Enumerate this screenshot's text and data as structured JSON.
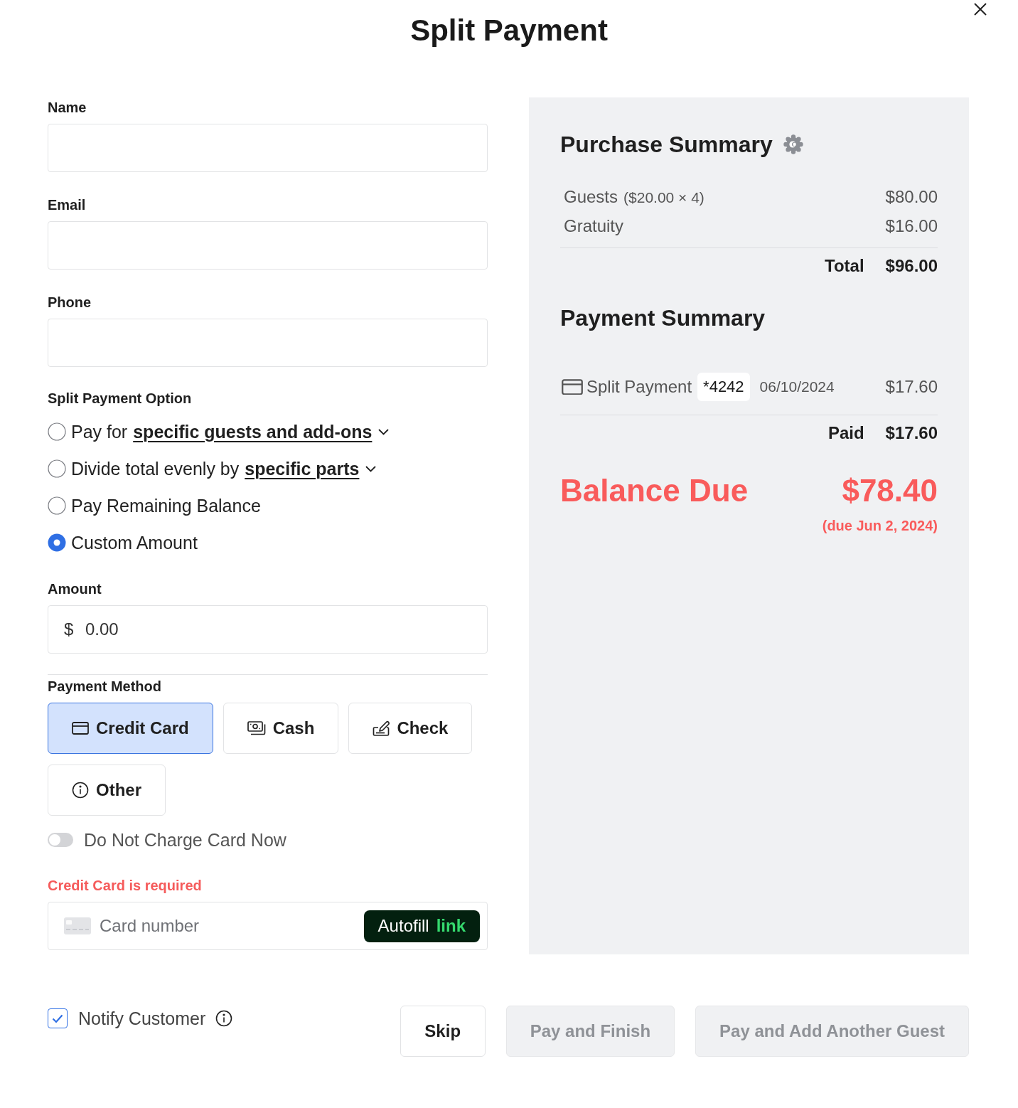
{
  "dialog": {
    "title": "Split Payment"
  },
  "form": {
    "fields": [
      {
        "label": "Name"
      },
      {
        "label": "Email"
      },
      {
        "label": "Phone"
      }
    ],
    "split_option": {
      "label": "Split Payment Option",
      "options": [
        {
          "text": "Pay for",
          "link": "specific guests and add-ons",
          "selected": false
        },
        {
          "text": "Divide total evenly by",
          "link": "specific parts",
          "selected": false
        },
        {
          "text": "Pay Remaining Balance",
          "selected": false
        },
        {
          "text": "Custom Amount",
          "selected": true
        }
      ]
    },
    "amount": {
      "label": "Amount",
      "prefix": "$",
      "value": "0.00"
    },
    "payment_method": {
      "label": "Payment Method",
      "methods": [
        {
          "kind": "card",
          "label": "Credit Card",
          "selected": true
        },
        {
          "kind": "cash",
          "label": "Cash",
          "selected": false
        },
        {
          "kind": "check",
          "label": "Check",
          "selected": false
        },
        {
          "kind": "other",
          "label": "Other",
          "selected": false
        }
      ]
    },
    "charge_toggle": {
      "label": "Do Not Charge Card Now",
      "on": false
    },
    "card_error": "Credit Card is required",
    "card_field": {
      "placeholder": "Card number",
      "autofill": {
        "label": "Autofill",
        "brand": "link"
      }
    }
  },
  "purchase_summary": {
    "title": "Purchase Summary",
    "items": [
      {
        "label": "Guests",
        "detail": "($20.00 × 4)",
        "amount": "$80.00"
      },
      {
        "label": "Gratuity",
        "amount": "$16.00"
      }
    ],
    "total": {
      "label": "Total",
      "amount": "$96.00"
    }
  },
  "payment_summary": {
    "title": "Payment Summary",
    "payments": [
      {
        "label": "Split Payment",
        "card": "*4242",
        "date": "06/10/2024",
        "amount": "$17.60"
      }
    ],
    "paid": {
      "label": "Paid",
      "amount": "$17.60"
    }
  },
  "balance": {
    "label": "Balance Due",
    "amount": "$78.40",
    "due": "(due Jun 2, 2024)"
  },
  "footer": {
    "notify": {
      "label": "Notify Customer",
      "checked": true
    },
    "buttons": [
      {
        "label": "Skip",
        "disabled": false
      },
      {
        "label": "Pay and Finish",
        "disabled": true
      },
      {
        "label": "Pay and Add Another Guest",
        "disabled": true
      }
    ]
  }
}
